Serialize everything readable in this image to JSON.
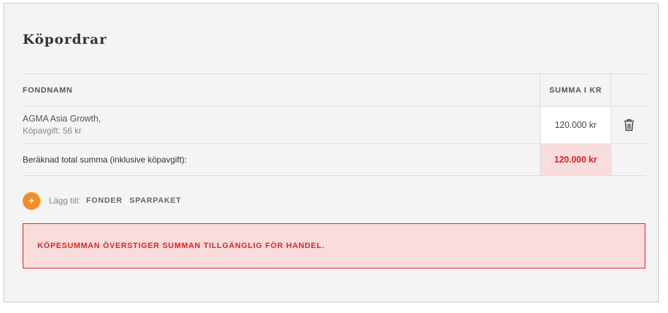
{
  "panel": {
    "title": "Köpordrar"
  },
  "table": {
    "columns": {
      "name": "FONDNAMN",
      "sum": "SUMMA I KR"
    },
    "rows": [
      {
        "fund_name": "AGMA Asia Growth,",
        "fee": "Köpavgift: 56 kr",
        "amount": "120.000 kr"
      }
    ],
    "total": {
      "label": "Beräknad total summa (inklusive köpavgift):",
      "amount": "120.000 kr"
    }
  },
  "add": {
    "button_label": "+",
    "label": "Lägg till:",
    "links": [
      "FONDER",
      "SPARPAKET"
    ]
  },
  "error": {
    "message": "KÖPESUMMAN ÖVERSTIGER SUMMAN TILLGÄNGLIG FÖR HANDEL."
  },
  "icons": {
    "delete": "trash-icon",
    "add": "plus-icon"
  },
  "colors": {
    "accent_orange": "#f28e23",
    "error_red": "#e0221f",
    "error_bg": "#f9dcdc",
    "panel_bg": "#f4f4f4"
  }
}
